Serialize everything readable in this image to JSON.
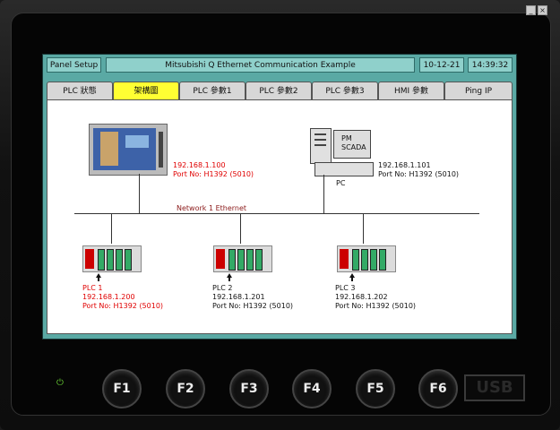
{
  "header": {
    "panel_setup": "Panel Setup",
    "title": "Mitsubishi Q Ethernet Communication Example",
    "date": "10-12-21",
    "time": "14:39:32"
  },
  "tabs": [
    {
      "label": "PLC 狀態"
    },
    {
      "label": "架構圖"
    },
    {
      "label": "PLC 參數1"
    },
    {
      "label": "PLC 參數2"
    },
    {
      "label": "PLC 參數3"
    },
    {
      "label": "HMI 參數"
    },
    {
      "label": "Ping IP"
    }
  ],
  "diagram": {
    "hmi_ip": "192.168.1.100",
    "hmi_port": "Port No: H1392 (5010)",
    "pc_label": "PC",
    "pc_screen": "PM\nSCADA",
    "pc_ip": "192.168.1.101",
    "pc_port": "Port No: H1392 (5010)",
    "network_label": "Network 1 Ethernet",
    "plc1_name": "PLC 1",
    "plc1_ip": "192.168.1.200",
    "plc1_port": "Port No: H1392 (5010)",
    "plc2_name": "PLC 2",
    "plc2_ip": "192.168.1.201",
    "plc2_port": "Port No: H1392 (5010)",
    "plc3_name": "PLC 3",
    "plc3_ip": "192.168.1.202",
    "plc3_port": "Port No: H1392 (5010)"
  },
  "fkeys": [
    "F1",
    "F2",
    "F3",
    "F4",
    "F5",
    "F6"
  ],
  "usb_label": "USB",
  "colors": {
    "accent_tab": "#ffff33",
    "screen_bg": "#5aa9a4",
    "red_text": "#e00000"
  }
}
